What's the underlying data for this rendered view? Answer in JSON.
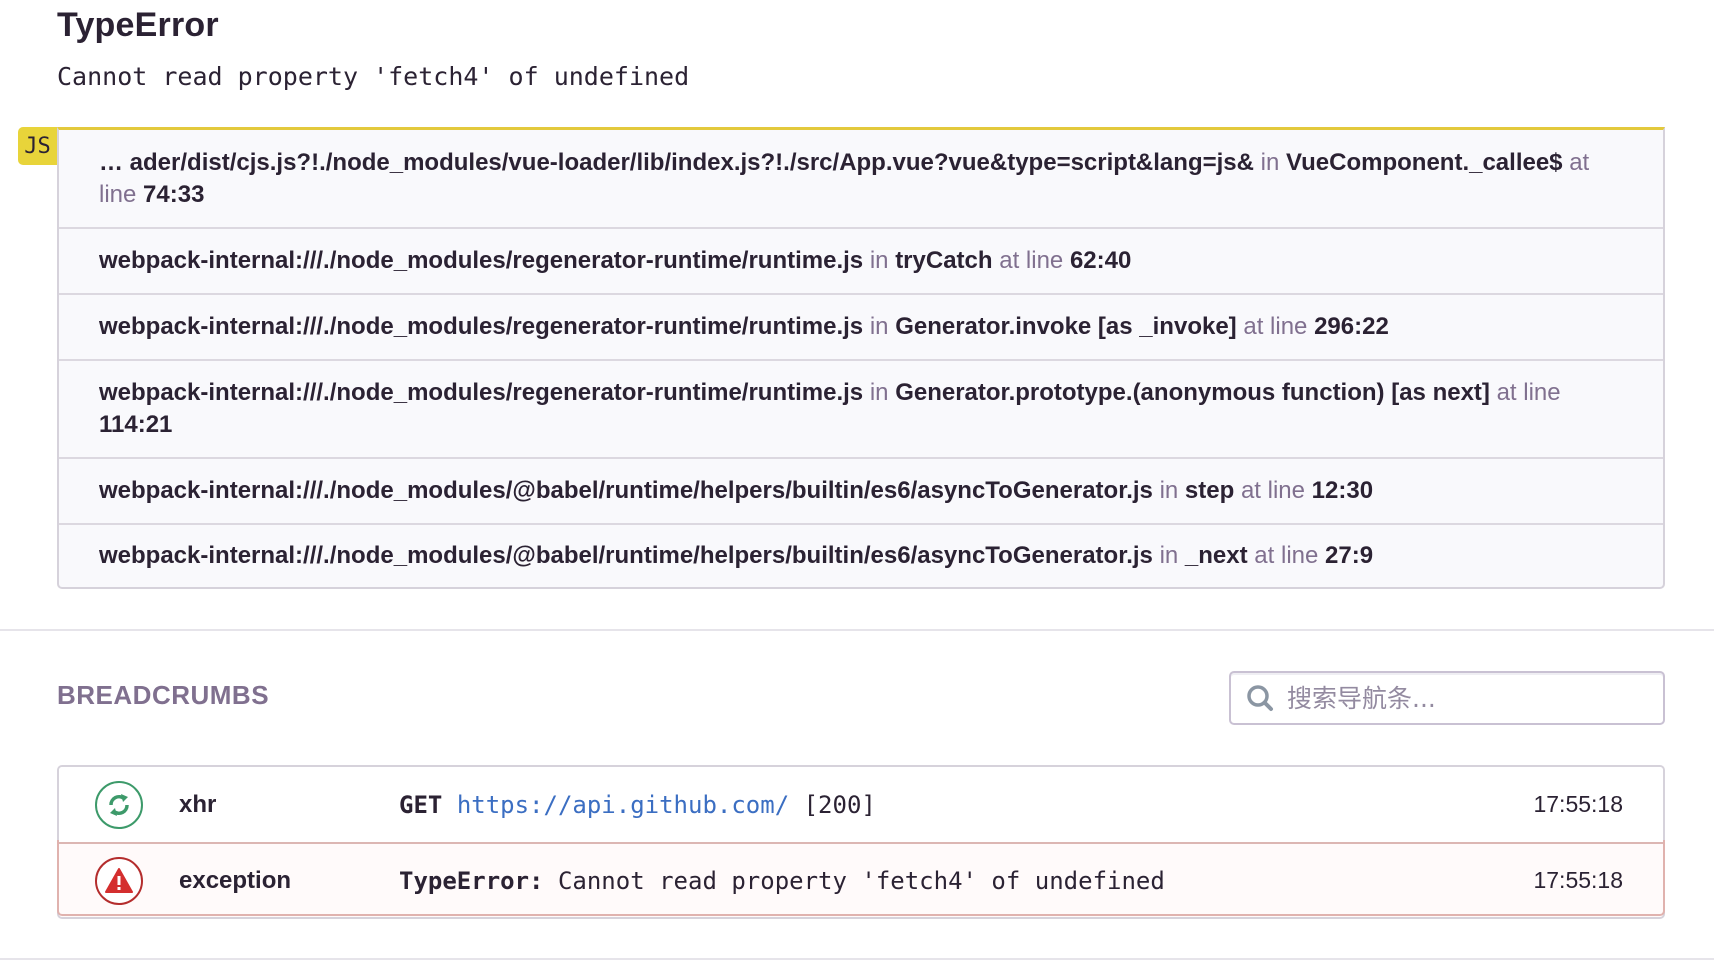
{
  "error": {
    "title": "TypeError",
    "message": "Cannot read property 'fetch4' of undefined"
  },
  "stacktrace": {
    "platform_badge": "JS",
    "in_label": "in",
    "at_line_label": "at line",
    "frames": [
      {
        "file": "… ader/dist/cjs.js?!./node_modules/vue-loader/lib/index.js?!./src/App.vue?vue&type=script&lang=js&",
        "function": "VueComponent._callee$",
        "line": "74:33"
      },
      {
        "file": "webpack-internal:///./node_modules/regenerator-runtime/runtime.js",
        "function": "tryCatch",
        "line": "62:40"
      },
      {
        "file": "webpack-internal:///./node_modules/regenerator-runtime/runtime.js",
        "function": "Generator.invoke [as _invoke]",
        "line": "296:22"
      },
      {
        "file": "webpack-internal:///./node_modules/regenerator-runtime/runtime.js",
        "function": "Generator.prototype.(anonymous function) [as next]",
        "line": "114:21"
      },
      {
        "file": "webpack-internal:///./node_modules/@babel/runtime/helpers/builtin/es6/asyncToGenerator.js",
        "function": "step",
        "line": "12:30"
      },
      {
        "file": "webpack-internal:///./node_modules/@babel/runtime/helpers/builtin/es6/asyncToGenerator.js",
        "function": "_next",
        "line": "27:9"
      }
    ]
  },
  "breadcrumbs": {
    "title": "BREADCRUMBS",
    "search_placeholder": "搜索导航条...",
    "items": [
      {
        "type": "xhr",
        "icon": "refresh-icon",
        "method": "GET",
        "url": "https://api.github.com/",
        "status": "[200]",
        "time": "17:55:18",
        "color": "#3d9a6a"
      },
      {
        "type": "exception",
        "icon": "warning-icon",
        "error_type": "TypeError:",
        "message": "Cannot read property 'fetch4' of undefined",
        "time": "17:55:18",
        "color": "#b42d2d"
      }
    ]
  },
  "colors": {
    "accent_yellow": "#e3c93c",
    "text": "#2b2233",
    "muted": "#80708f",
    "link": "#3b6ec2"
  }
}
